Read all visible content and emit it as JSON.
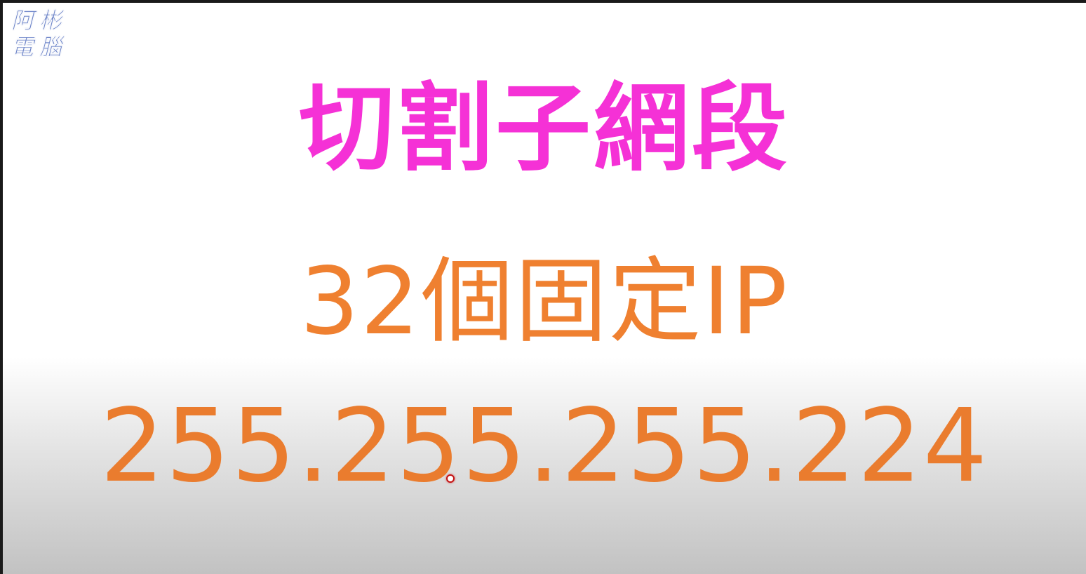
{
  "logo": {
    "chars": [
      "阿",
      "彬",
      "電",
      "腦"
    ]
  },
  "slide": {
    "title": "切割子網段",
    "subtitle": "32個固定IP",
    "subnet_mask": "255.255.255.224"
  },
  "colors": {
    "title": "#f531d6",
    "subtitle": "#ef8030",
    "subnet_mask": "#ea7c2e",
    "logo": "#6f86c9"
  },
  "icons": {
    "cursor": "red-circle-cursor-icon"
  }
}
